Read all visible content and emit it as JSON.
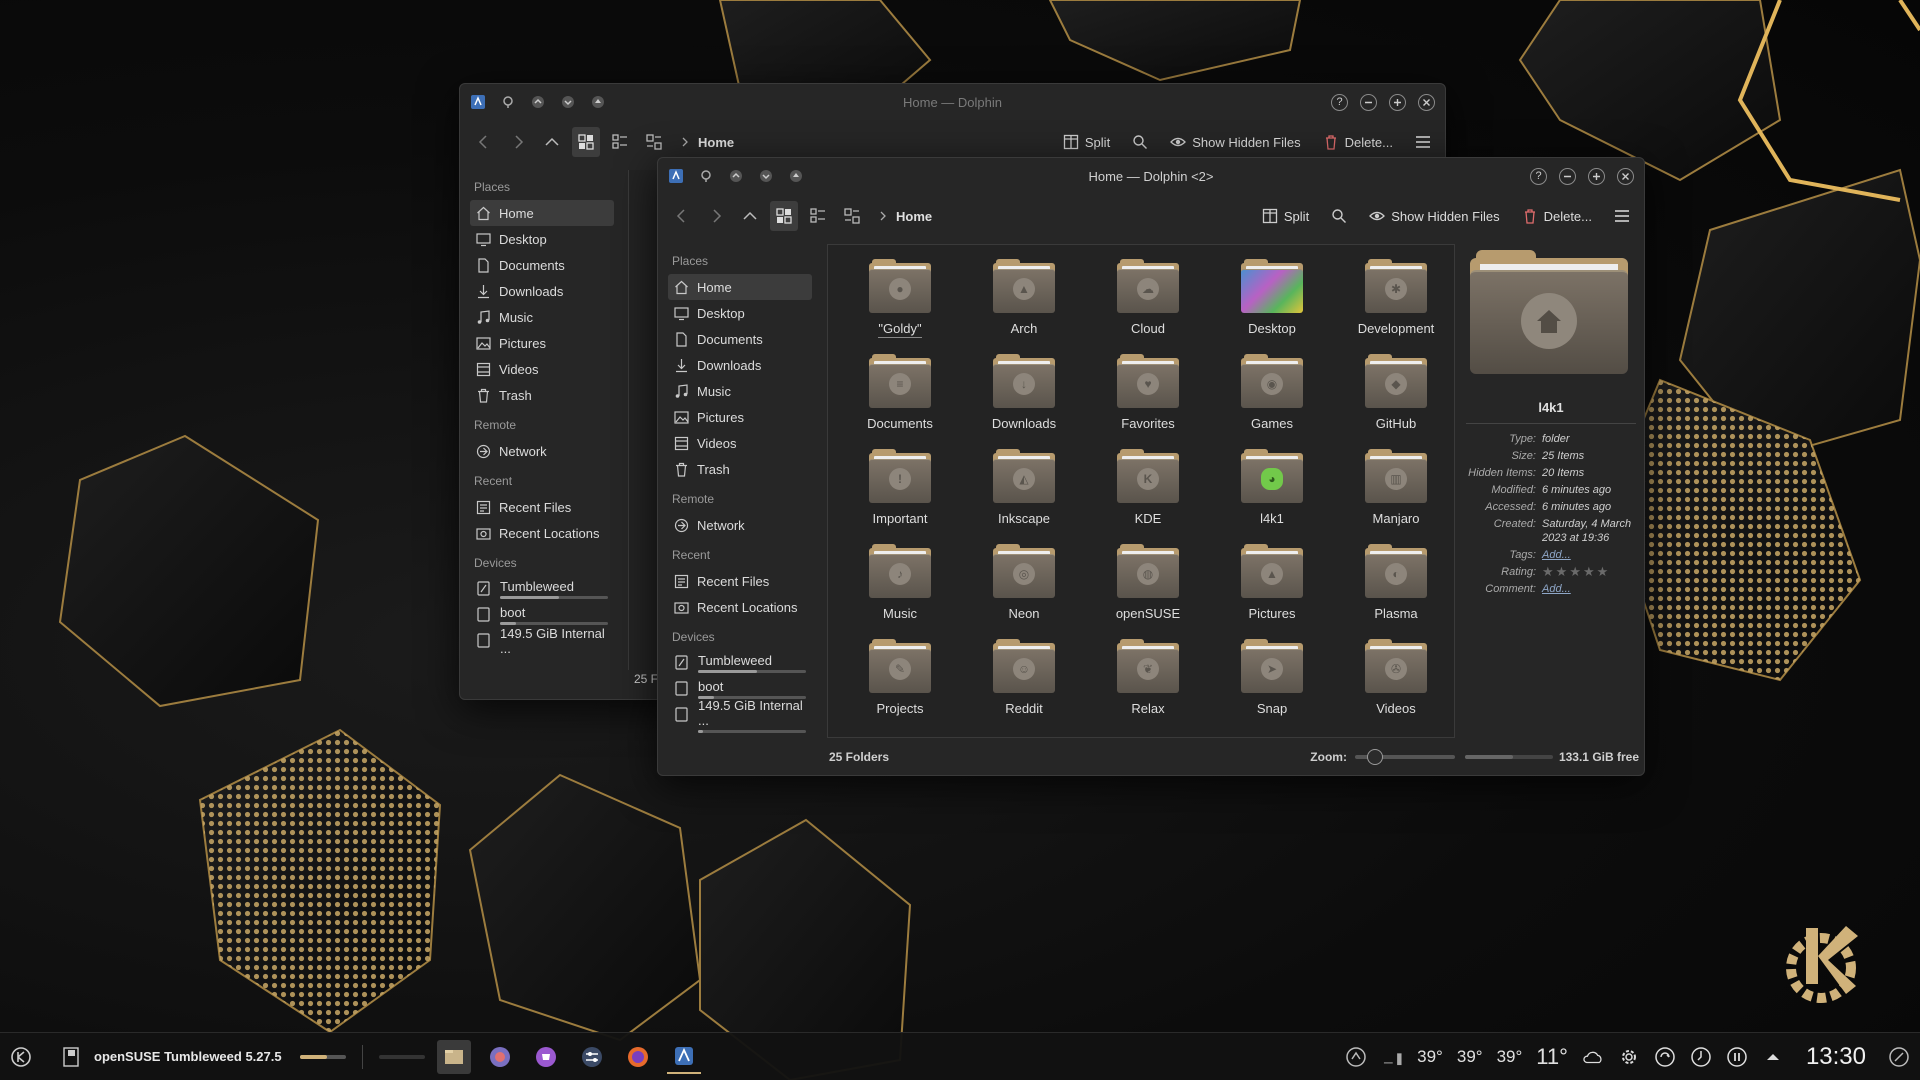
{
  "colors": {
    "accent": "#b79b6e",
    "bg": "#262626",
    "selection": "#3c3c3c"
  },
  "back_window": {
    "title": "Home — Dolphin",
    "breadcrumb": "Home",
    "tools": {
      "split": "Split",
      "hidden": "Show Hidden Files",
      "delete": "Delete..."
    },
    "sidebar": {
      "places_title": "Places",
      "places": [
        "Home",
        "Desktop",
        "Documents",
        "Downloads",
        "Music",
        "Pictures",
        "Videos",
        "Trash"
      ],
      "remote_title": "Remote",
      "remote": [
        "Network"
      ],
      "recent_title": "Recent",
      "recent": [
        "Recent Files",
        "Recent Locations"
      ],
      "devices_title": "Devices",
      "devices": [
        {
          "label": "Tumbleweed",
          "usage": 0.55
        },
        {
          "label": "boot",
          "usage": 0.15
        },
        {
          "label": "149.5 GiB Internal ...",
          "usage": 0.05
        }
      ]
    },
    "status_text": "25 Fo"
  },
  "front_window": {
    "title": "Home — Dolphin <2>",
    "breadcrumb": "Home",
    "tools": {
      "split": "Split",
      "hidden": "Show Hidden Files",
      "delete": "Delete..."
    },
    "sidebar": {
      "places_title": "Places",
      "places": [
        "Home",
        "Desktop",
        "Documents",
        "Downloads",
        "Music",
        "Pictures",
        "Videos",
        "Trash"
      ],
      "remote_title": "Remote",
      "remote": [
        "Network"
      ],
      "recent_title": "Recent",
      "recent": [
        "Recent Files",
        "Recent Locations"
      ],
      "devices_title": "Devices",
      "devices": [
        {
          "label": "Tumbleweed",
          "usage": 0.55
        },
        {
          "label": "boot",
          "usage": 0.15
        },
        {
          "label": "149.5 GiB Internal ...",
          "usage": 0.05
        }
      ]
    },
    "folders": [
      {
        "name": "\"Goldy\"",
        "emblem": "penguin-icon",
        "glyph": "●"
      },
      {
        "name": "Arch",
        "emblem": "arch-icon",
        "glyph": "▲"
      },
      {
        "name": "Cloud",
        "emblem": "cloud-icon",
        "glyph": "☁"
      },
      {
        "name": "Desktop",
        "emblem": "desktop-wallpaper-icon",
        "glyph": ""
      },
      {
        "name": "Development",
        "emblem": "gear-icon",
        "glyph": "✱"
      },
      {
        "name": "Documents",
        "emblem": "document-icon",
        "glyph": "≡"
      },
      {
        "name": "Downloads",
        "emblem": "download-icon",
        "glyph": "↓"
      },
      {
        "name": "Favorites",
        "emblem": "heart-icon",
        "glyph": "♥"
      },
      {
        "name": "Games",
        "emblem": "gamepad-icon",
        "glyph": "◉"
      },
      {
        "name": "GitHub",
        "emblem": "github-icon",
        "glyph": "◆"
      },
      {
        "name": "Important",
        "emblem": "exclamation-icon",
        "glyph": "!"
      },
      {
        "name": "Inkscape",
        "emblem": "inkscape-icon",
        "glyph": "◭"
      },
      {
        "name": "KDE",
        "emblem": "kde-icon",
        "glyph": "K"
      },
      {
        "name": "l4k1",
        "emblem": "chameleon-icon",
        "glyph": "◕"
      },
      {
        "name": "Manjaro",
        "emblem": "manjaro-icon",
        "glyph": "▥"
      },
      {
        "name": "Music",
        "emblem": "music-note-icon",
        "glyph": "♪"
      },
      {
        "name": "Neon",
        "emblem": "neon-icon",
        "glyph": "◎"
      },
      {
        "name": "openSUSE",
        "emblem": "opensuse-icon",
        "glyph": "◍"
      },
      {
        "name": "Pictures",
        "emblem": "picture-icon",
        "glyph": "▲"
      },
      {
        "name": "Plasma",
        "emblem": "plasma-icon",
        "glyph": "◐"
      },
      {
        "name": "Projects",
        "emblem": "projects-icon",
        "glyph": "✎"
      },
      {
        "name": "Reddit",
        "emblem": "reddit-icon",
        "glyph": "☺"
      },
      {
        "name": "Relax",
        "emblem": "leaf-icon",
        "glyph": "❦"
      },
      {
        "name": "Snap",
        "emblem": "snap-icon",
        "glyph": "➤"
      },
      {
        "name": "Videos",
        "emblem": "film-reel-icon",
        "glyph": "✇"
      }
    ],
    "info": {
      "name": "l4k1",
      "rows": [
        {
          "k": "Type:",
          "v": "folder"
        },
        {
          "k": "Size:",
          "v": "25 Items"
        },
        {
          "k": "Hidden Items:",
          "v": "20 Items"
        },
        {
          "k": "Modified:",
          "v": "6 minutes ago"
        },
        {
          "k": "Accessed:",
          "v": "6 minutes ago"
        },
        {
          "k": "Created:",
          "v": "Saturday, 4 March 2023 at 19:36"
        }
      ],
      "tags_label": "Tags:",
      "tags_value": "Add...",
      "rating_label": "Rating:",
      "rating": 0,
      "rating_max": 5,
      "comment_label": "Comment:",
      "comment_value": "Add..."
    },
    "status": {
      "count": "25 Folders",
      "zoom_label": "Zoom:",
      "zoom": 0.2,
      "free": "133.1 GiB free",
      "free_fraction": 0.55
    }
  },
  "panel": {
    "system_name": "openSUSE Tumbleweed 5.27.5",
    "volume": 0.6,
    "temps": [
      "39°",
      "39°",
      "39°"
    ],
    "weather_temp": "11°",
    "clock": "13:30",
    "apps": [
      "file-manager-icon",
      "konqi-icon",
      "discover-shop-icon",
      "system-settings-icon",
      "firefox-icon",
      "dolphin-icon"
    ]
  }
}
